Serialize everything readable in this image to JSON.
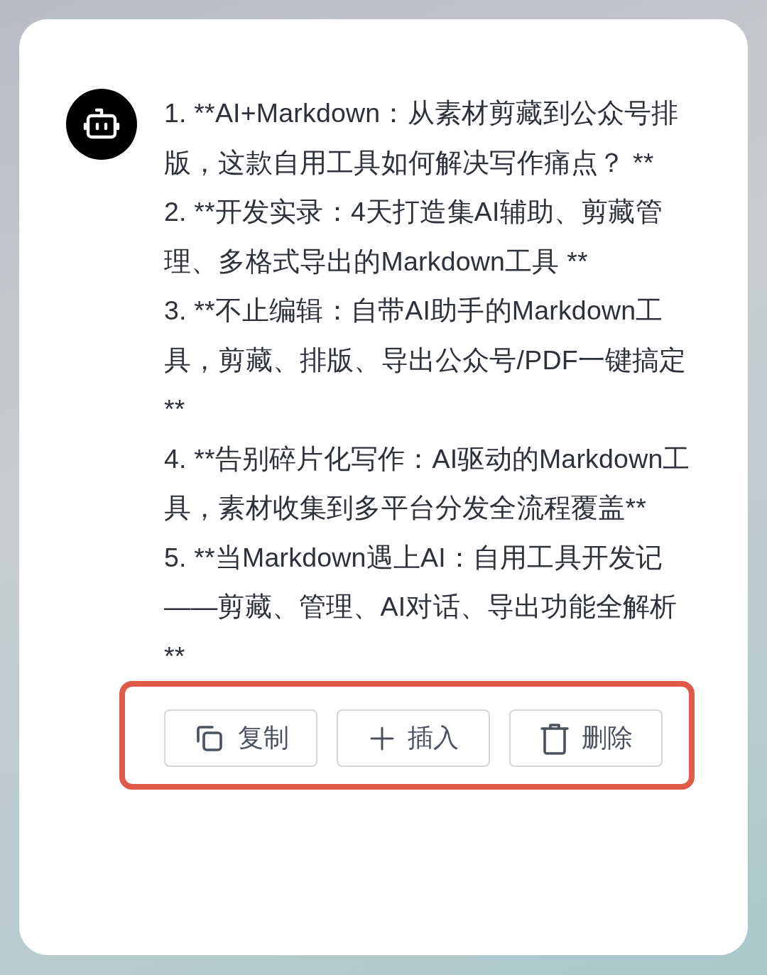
{
  "message": {
    "items": [
      "1. **AI+Markdown：从素材剪藏到公众号排版，这款自用工具如何解决写作痛点？ **",
      "2. **开发实录：4天打造集AI辅助、剪藏管理、多格式导出的Markdown工具 **",
      "3. **不止编辑：自带AI助手的Markdown工具，剪藏、排版、导出公众号/PDF一键搞定**",
      "4. **告别碎片化写作：AI驱动的Markdown工具，素材收集到多平台分发全流程覆盖**",
      "5. **当Markdown遇上AI：自用工具开发记——剪藏、管理、AI对话、导出功能全解析**"
    ]
  },
  "actions": [
    {
      "kind": "copy",
      "label": "复制"
    },
    {
      "kind": "insert",
      "label": "插入"
    },
    {
      "kind": "delete",
      "label": "删除"
    }
  ]
}
